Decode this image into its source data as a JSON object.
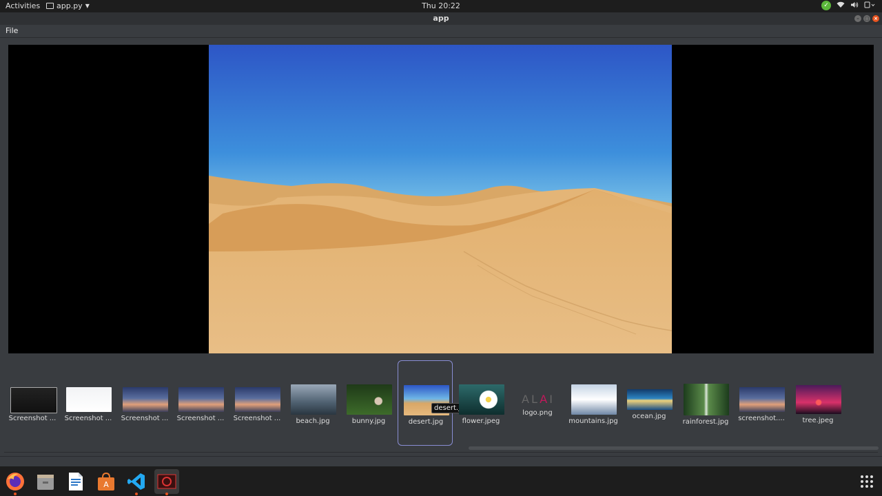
{
  "topbar": {
    "activities": "Activities",
    "app_menu": "app.py",
    "clock": "Thu 20:22"
  },
  "window": {
    "title": "app"
  },
  "menubar": {
    "file": "File"
  },
  "viewer": {
    "current_image": "desert.jpg"
  },
  "thumbnails": [
    {
      "label": "Screenshot ...",
      "icon": "screenshot-dark-icon"
    },
    {
      "label": "Screenshot ...",
      "icon": "screenshot-light-icon"
    },
    {
      "label": "Screenshot ...",
      "icon": "screenshot-desktop-icon"
    },
    {
      "label": "Screenshot ...",
      "icon": "screenshot-desktop-icon"
    },
    {
      "label": "Screenshot ...",
      "icon": "screenshot-desktop-icon"
    },
    {
      "label": "beach.jpg",
      "icon": "beach-thumbnail"
    },
    {
      "label": "bunny.jpg",
      "icon": "bunny-thumbnail"
    },
    {
      "label": "desert.jpg",
      "icon": "desert-thumbnail"
    },
    {
      "label": "flower.jpeg",
      "icon": "flower-thumbnail"
    },
    {
      "label": "logo.png",
      "icon": "logo-thumbnail"
    },
    {
      "label": "mountains.jpg",
      "icon": "mountains-thumbnail"
    },
    {
      "label": "ocean.jpg",
      "icon": "ocean-thumbnail"
    },
    {
      "label": "rainforest.jpg",
      "icon": "rainforest-thumbnail"
    },
    {
      "label": "screenshot....",
      "icon": "screenshot-desktop-icon"
    },
    {
      "label": "tree.jpeg",
      "icon": "tree-thumbnail"
    }
  ],
  "tooltip": "desert.jpg",
  "logo_text": "ALAI",
  "colors": {
    "accent": "#e95420",
    "selection": "#8a8ed4",
    "status_ok": "#5bb73a"
  }
}
